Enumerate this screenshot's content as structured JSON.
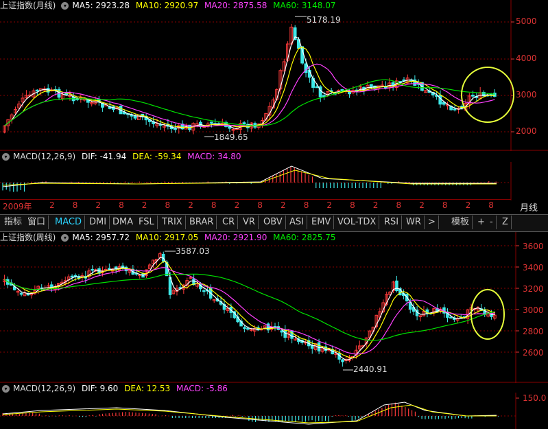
{
  "monthly": {
    "title": "上证指数(月线)",
    "ma5": "MA5: 2923.28",
    "ma10": "MA10: 2920.97",
    "ma20": "MA20: 2875.58",
    "ma60": "MA60: 3148.07",
    "y_ticks": [
      "5000",
      "4000",
      "3000",
      "2000"
    ],
    "high_label": "5178.19",
    "low_label": "1849.65",
    "macd": {
      "name": "MACD(12,26,9)",
      "dif": "DIF: -41.94",
      "dea": "DEA: -59.34",
      "macd": "MACD: 34.80"
    }
  },
  "date_axis": {
    "start": "2009年",
    "labels": [
      "2",
      "8",
      "2",
      "8",
      "2",
      "8",
      "2",
      "8",
      "2",
      "8",
      "2",
      "8",
      "2",
      "8",
      "2",
      "8",
      "2",
      "8",
      "2",
      "8"
    ],
    "period": "月线"
  },
  "tabs": [
    "指标",
    "窗口",
    "MACD",
    "DMI",
    "DMA",
    "FSL",
    "TRIX",
    "BRAR",
    "CR",
    "VR",
    "OBV",
    "ASI",
    "EMV",
    "VOL-TDX",
    "RSI",
    "WR",
    ">",
    "模板",
    "+",
    "-",
    "Z"
  ],
  "weekly": {
    "title": "上证指数(周线)",
    "ma5": "MA5: 2957.72",
    "ma10": "MA10: 2917.05",
    "ma20": "MA20: 2921.90",
    "ma60": "MA60: 2825.75",
    "y_ticks": [
      "3600",
      "3400",
      "3200",
      "3000",
      "2800",
      "2600"
    ],
    "high_label": "3587.03",
    "low_label": "2440.91",
    "macd": {
      "name": "MACD(12,26,9)",
      "dif": "DIF: 9.60",
      "dea": "DEA: 12.53",
      "macd": "MACD: -5.86",
      "tick": "150.0"
    }
  },
  "colors": {
    "up": "#ff3b3b",
    "down": "#3ee8e8",
    "ma5": "#ffffff",
    "ma10": "#ffff00",
    "ma20": "#ff40ff",
    "ma60": "#00e000",
    "grid": "#8a0000",
    "annot": "#e6ff3a"
  }
}
